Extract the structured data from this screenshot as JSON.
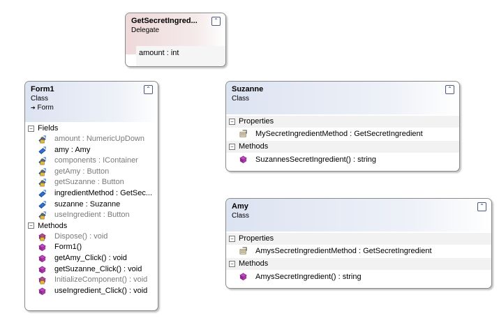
{
  "delegate": {
    "title": "GetSecretIngred...",
    "stereotype": "Delegate",
    "params": [
      "amount : int"
    ]
  },
  "form1": {
    "title": "Form1",
    "stereotype": "Class",
    "base": "Form",
    "fields_label": "Fields",
    "fields": [
      "amount : NumericUpDown",
      "amy : Amy",
      "components : IContainer",
      "getAmy : Button",
      "getSuzanne : Button",
      "ingredientMethod  : GetSec...",
      "suzanne : Suzanne",
      "useIngredient : Button"
    ],
    "methods_label": "Methods",
    "methods": [
      "Dispose() : void",
      "Form1()",
      "getAmy_Click() : void",
      "getSuzanne_Click() : void",
      "InitializeComponent() : void",
      "useIngredient_Click() : void"
    ]
  },
  "suzanne": {
    "title": "Suzanne",
    "stereotype": "Class",
    "properties_label": "Properties",
    "properties": [
      "MySecretIngredientMethod : GetSecretIngredient"
    ],
    "methods_label": "Methods",
    "methods": [
      "SuzannesSecretIngredient() : string"
    ]
  },
  "amy": {
    "title": "Amy",
    "stereotype": "Class",
    "properties_label": "Properties",
    "properties": [
      "AmysSecretIngredientMethod : GetSecretIngredient"
    ],
    "methods_label": "Methods",
    "methods": [
      "AmysSecretIngredient() : string"
    ]
  },
  "glyphs": {
    "collapse": "⌃",
    "minus": "−",
    "inherit_arrow": "➔"
  },
  "colors": {
    "class_header": "#dce3f1",
    "delegate_header": "#eed9da",
    "private_member": "#7a7a7a"
  }
}
